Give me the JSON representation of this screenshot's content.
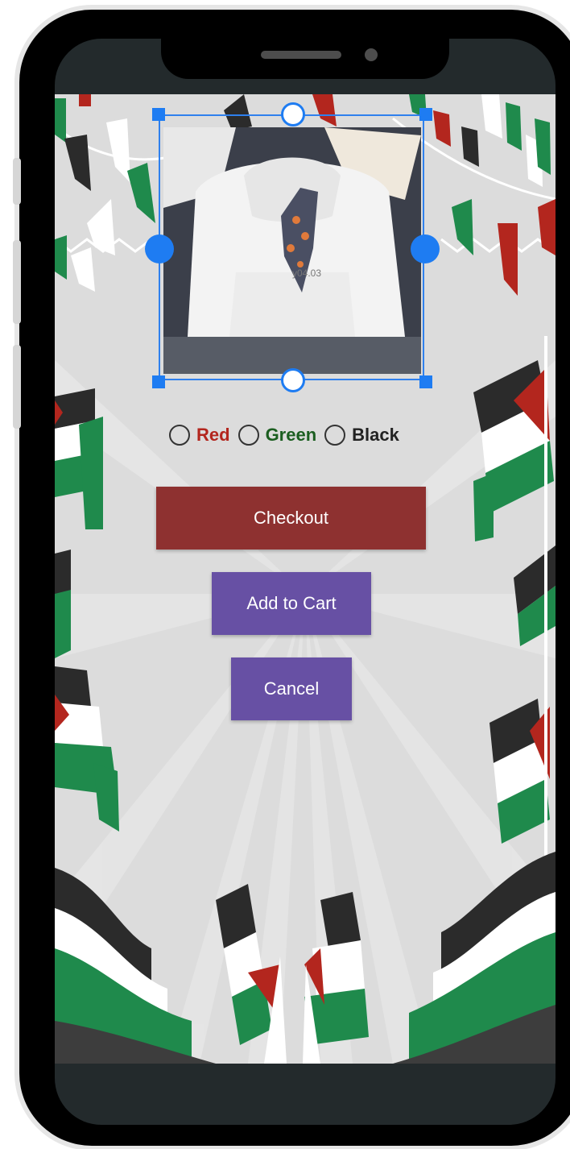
{
  "colors": {
    "checkout_bg": "#8e3130",
    "primary_bg": "#6750a4",
    "handle": "#1e7cf2",
    "red_label": "#b3261e",
    "green_label": "#1b5e20",
    "black_label": "#222222"
  },
  "product": {
    "image_alt": "White hoodie with Palestine map print",
    "print_text": "y04.03"
  },
  "color_options": [
    {
      "label": "Red",
      "selected": false
    },
    {
      "label": "Green",
      "selected": false
    },
    {
      "label": "Black",
      "selected": false
    }
  ],
  "buttons": {
    "checkout": "Checkout",
    "add_to_cart": "Add to Cart",
    "cancel": "Cancel"
  },
  "icons": {
    "crop_handle": "crop-handle-icon",
    "radio": "radio-unchecked-icon"
  }
}
